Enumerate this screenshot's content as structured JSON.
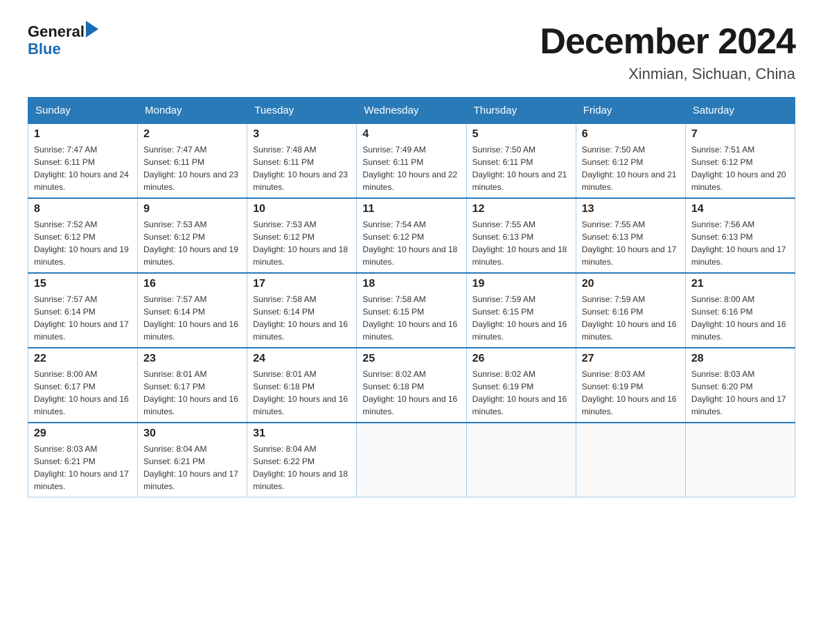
{
  "logo": {
    "text_general": "General",
    "text_blue": "Blue"
  },
  "title": "December 2024",
  "subtitle": "Xinmian, Sichuan, China",
  "weekdays": [
    "Sunday",
    "Monday",
    "Tuesday",
    "Wednesday",
    "Thursday",
    "Friday",
    "Saturday"
  ],
  "days": [
    {
      "num": "1",
      "sunrise": "7:47 AM",
      "sunset": "6:11 PM",
      "daylight": "10 hours and 24 minutes."
    },
    {
      "num": "2",
      "sunrise": "7:47 AM",
      "sunset": "6:11 PM",
      "daylight": "10 hours and 23 minutes."
    },
    {
      "num": "3",
      "sunrise": "7:48 AM",
      "sunset": "6:11 PM",
      "daylight": "10 hours and 23 minutes."
    },
    {
      "num": "4",
      "sunrise": "7:49 AM",
      "sunset": "6:11 PM",
      "daylight": "10 hours and 22 minutes."
    },
    {
      "num": "5",
      "sunrise": "7:50 AM",
      "sunset": "6:11 PM",
      "daylight": "10 hours and 21 minutes."
    },
    {
      "num": "6",
      "sunrise": "7:50 AM",
      "sunset": "6:12 PM",
      "daylight": "10 hours and 21 minutes."
    },
    {
      "num": "7",
      "sunrise": "7:51 AM",
      "sunset": "6:12 PM",
      "daylight": "10 hours and 20 minutes."
    },
    {
      "num": "8",
      "sunrise": "7:52 AM",
      "sunset": "6:12 PM",
      "daylight": "10 hours and 19 minutes."
    },
    {
      "num": "9",
      "sunrise": "7:53 AM",
      "sunset": "6:12 PM",
      "daylight": "10 hours and 19 minutes."
    },
    {
      "num": "10",
      "sunrise": "7:53 AM",
      "sunset": "6:12 PM",
      "daylight": "10 hours and 18 minutes."
    },
    {
      "num": "11",
      "sunrise": "7:54 AM",
      "sunset": "6:12 PM",
      "daylight": "10 hours and 18 minutes."
    },
    {
      "num": "12",
      "sunrise": "7:55 AM",
      "sunset": "6:13 PM",
      "daylight": "10 hours and 18 minutes."
    },
    {
      "num": "13",
      "sunrise": "7:55 AM",
      "sunset": "6:13 PM",
      "daylight": "10 hours and 17 minutes."
    },
    {
      "num": "14",
      "sunrise": "7:56 AM",
      "sunset": "6:13 PM",
      "daylight": "10 hours and 17 minutes."
    },
    {
      "num": "15",
      "sunrise": "7:57 AM",
      "sunset": "6:14 PM",
      "daylight": "10 hours and 17 minutes."
    },
    {
      "num": "16",
      "sunrise": "7:57 AM",
      "sunset": "6:14 PM",
      "daylight": "10 hours and 16 minutes."
    },
    {
      "num": "17",
      "sunrise": "7:58 AM",
      "sunset": "6:14 PM",
      "daylight": "10 hours and 16 minutes."
    },
    {
      "num": "18",
      "sunrise": "7:58 AM",
      "sunset": "6:15 PM",
      "daylight": "10 hours and 16 minutes."
    },
    {
      "num": "19",
      "sunrise": "7:59 AM",
      "sunset": "6:15 PM",
      "daylight": "10 hours and 16 minutes."
    },
    {
      "num": "20",
      "sunrise": "7:59 AM",
      "sunset": "6:16 PM",
      "daylight": "10 hours and 16 minutes."
    },
    {
      "num": "21",
      "sunrise": "8:00 AM",
      "sunset": "6:16 PM",
      "daylight": "10 hours and 16 minutes."
    },
    {
      "num": "22",
      "sunrise": "8:00 AM",
      "sunset": "6:17 PM",
      "daylight": "10 hours and 16 minutes."
    },
    {
      "num": "23",
      "sunrise": "8:01 AM",
      "sunset": "6:17 PM",
      "daylight": "10 hours and 16 minutes."
    },
    {
      "num": "24",
      "sunrise": "8:01 AM",
      "sunset": "6:18 PM",
      "daylight": "10 hours and 16 minutes."
    },
    {
      "num": "25",
      "sunrise": "8:02 AM",
      "sunset": "6:18 PM",
      "daylight": "10 hours and 16 minutes."
    },
    {
      "num": "26",
      "sunrise": "8:02 AM",
      "sunset": "6:19 PM",
      "daylight": "10 hours and 16 minutes."
    },
    {
      "num": "27",
      "sunrise": "8:03 AM",
      "sunset": "6:19 PM",
      "daylight": "10 hours and 16 minutes."
    },
    {
      "num": "28",
      "sunrise": "8:03 AM",
      "sunset": "6:20 PM",
      "daylight": "10 hours and 17 minutes."
    },
    {
      "num": "29",
      "sunrise": "8:03 AM",
      "sunset": "6:21 PM",
      "daylight": "10 hours and 17 minutes."
    },
    {
      "num": "30",
      "sunrise": "8:04 AM",
      "sunset": "6:21 PM",
      "daylight": "10 hours and 17 minutes."
    },
    {
      "num": "31",
      "sunrise": "8:04 AM",
      "sunset": "6:22 PM",
      "daylight": "10 hours and 18 minutes."
    }
  ],
  "labels": {
    "sunrise_prefix": "Sunrise: ",
    "sunset_prefix": "Sunset: ",
    "daylight_prefix": "Daylight: "
  }
}
